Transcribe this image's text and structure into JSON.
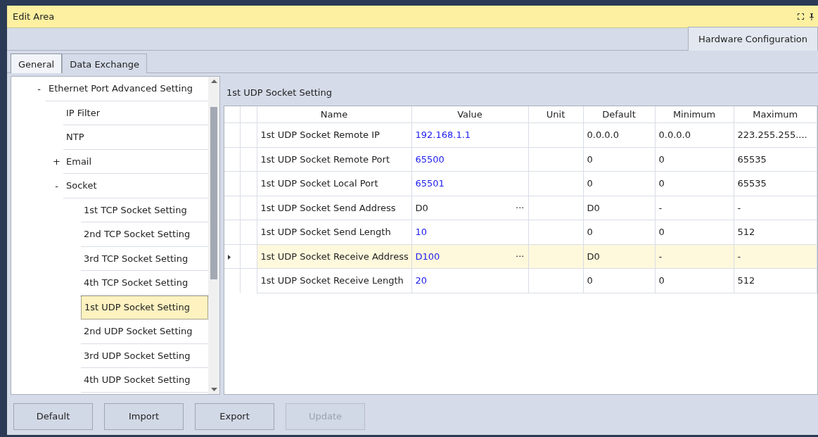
{
  "window": {
    "title": "Edit Area"
  },
  "doc_tabs": [
    {
      "label": "Hardware Configuration",
      "selected": true
    }
  ],
  "tabs": [
    {
      "label": "General",
      "selected": true
    },
    {
      "label": "Data Exchange",
      "selected": false
    }
  ],
  "tree": [
    {
      "label": "Ethernet Port Advanced Setting",
      "toggle": "-",
      "selected": false,
      "children": [
        {
          "label": "IP Filter",
          "selected": false
        },
        {
          "label": "NTP",
          "selected": false
        },
        {
          "label": "Email",
          "toggle": "+",
          "selected": false
        },
        {
          "label": "Socket",
          "toggle": "-",
          "selected": false,
          "children": [
            {
              "label": "1st TCP Socket Setting",
              "selected": false
            },
            {
              "label": "2nd TCP Socket Setting",
              "selected": false
            },
            {
              "label": "3rd TCP Socket Setting",
              "selected": false
            },
            {
              "label": "4th TCP Socket Setting",
              "selected": false
            },
            {
              "label": "1st UDP Socket Setting",
              "selected": true
            },
            {
              "label": "2nd UDP Socket Setting",
              "selected": false
            },
            {
              "label": "3rd UDP Socket Setting",
              "selected": false
            },
            {
              "label": "4th UDP Socket Setting",
              "selected": false
            }
          ]
        }
      ]
    }
  ],
  "section_title": "1st UDP Socket Setting",
  "table": {
    "columns": [
      "Name",
      "Value",
      "Unit",
      "Default",
      "Minimum",
      "Maximum"
    ],
    "rows": [
      {
        "name": "1st UDP Socket Remote IP",
        "value": "192.168.1.1",
        "changed": true,
        "default": "0.0.0.0",
        "minimum": "0.0.0.0",
        "maximum": "223.255.255....",
        "selected": false
      },
      {
        "name": "1st UDP Socket Remote Port",
        "value": "65500",
        "changed": true,
        "default": "0",
        "minimum": "0",
        "maximum": "65535",
        "selected": false
      },
      {
        "name": "1st UDP Socket Local Port",
        "value": "65501",
        "changed": true,
        "default": "0",
        "minimum": "0",
        "maximum": "65535",
        "selected": false
      },
      {
        "name": "1st UDP Socket Send Address",
        "value": "D0",
        "changed": false,
        "browse": "···",
        "default": "D0",
        "minimum": "-",
        "maximum": "-",
        "selected": false
      },
      {
        "name": "1st UDP Socket Send Length",
        "value": "10",
        "changed": true,
        "default": "0",
        "minimum": "0",
        "maximum": "512",
        "selected": false
      },
      {
        "name": "1st UDP Socket Receive Address",
        "value": "D100",
        "changed": true,
        "browse": "···",
        "default": "D0",
        "minimum": "-",
        "maximum": "-",
        "selected": true
      },
      {
        "name": "1st UDP Socket Receive Length",
        "value": "20",
        "changed": true,
        "default": "0",
        "minimum": "0",
        "maximum": "512",
        "selected": false
      }
    ]
  },
  "buttons": [
    {
      "label": "Default",
      "disabled": false
    },
    {
      "label": "Import",
      "disabled": false
    },
    {
      "label": "Export",
      "disabled": false
    },
    {
      "label": "Update",
      "disabled": true
    }
  ]
}
